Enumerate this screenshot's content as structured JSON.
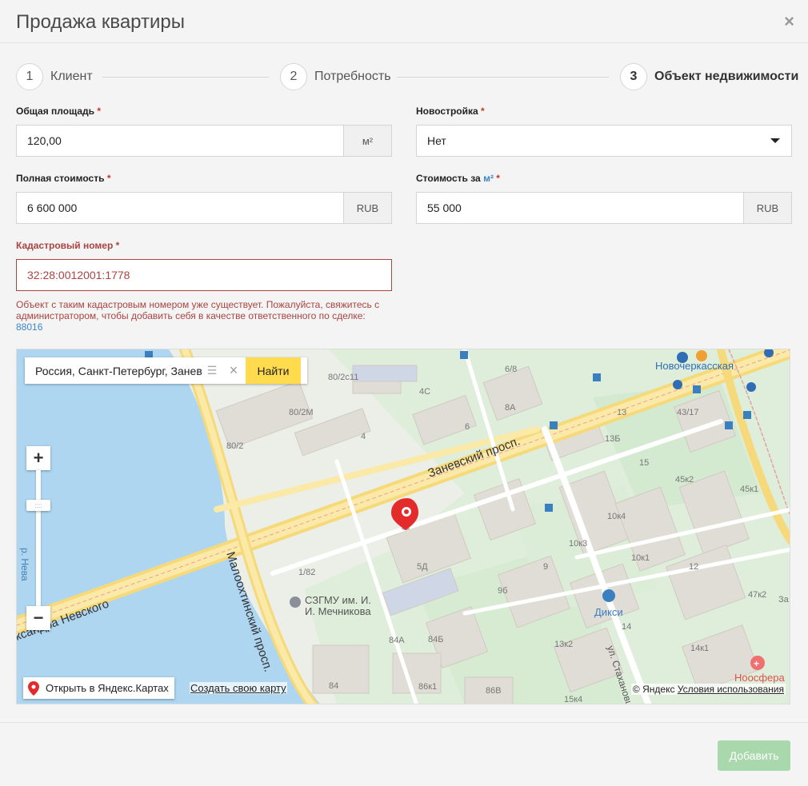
{
  "modal": {
    "title": "Продажа квартиры",
    "close_label": "×"
  },
  "steps": [
    {
      "number": "1",
      "label": "Клиент",
      "active": false
    },
    {
      "number": "2",
      "label": "Потребность",
      "active": false
    },
    {
      "number": "3",
      "label": "Объект недвижимости",
      "active": true
    }
  ],
  "form": {
    "total_area": {
      "label": "Общая площадь",
      "required_mark": "*",
      "value": "120,00",
      "unit": "м²"
    },
    "new_building": {
      "label": "Новостройка",
      "required_mark": "*",
      "value": "Нет"
    },
    "total_price": {
      "label": "Полная стоимость",
      "required_mark": "*",
      "value": "6 600 000",
      "unit": "RUB"
    },
    "price_per_m2": {
      "label_prefix": "Стоимость за",
      "label_unit": "м²",
      "required_mark": "*",
      "value": "55 000",
      "unit": "RUB"
    },
    "cadastral": {
      "label": "Кадастровый номер",
      "required_mark": "*",
      "value": "32:28:0012001:1778"
    },
    "error": {
      "message": "Объект с таким кадастровым номером уже существует. Пожалуйста, свяжитесь с администратором, чтобы добавить себя в качестве ответственного по сделке:",
      "link": "88016"
    }
  },
  "map": {
    "search_value": "Россия, Санкт-Петербург, Заневс",
    "search_button": "Найти",
    "zoom_in": "+",
    "zoom_out": "−",
    "open_button": "Открыть в Яндекс.Картах",
    "create_link": "Создать свою карту",
    "copyright": "© Яндекс",
    "terms": "Условия использования",
    "labels": {
      "zanevsky": "Заневский просп.",
      "malookhtinsky": "Малоохтинский просп.",
      "nevsky": "ксандра Невского",
      "neva": "р. Нева",
      "szgmu1": "СЗГМУ им. И.",
      "szgmu2": "И. Мечникова",
      "dixy": "Дикси",
      "noosfera": "Ноосфера",
      "novocherkasskaya": "Новочеркасская",
      "stakhanovtsev": "ул. Стахановцев",
      "h_80_2c11": "80/2с11",
      "h_80_2m": "80/2М",
      "h_80_2": "80/2",
      "h_4c": "4С",
      "h_6_8": "6/8",
      "h_8a": "8А",
      "h_4": "4",
      "h_6": "6",
      "h_13": "13",
      "h_43_17": "43/17",
      "h_13b": "13Б",
      "h_15": "15",
      "h_45k2": "45к2",
      "h_45k1": "45к1",
      "h_10k4": "10к4",
      "h_10k3": "10к3",
      "h_10k1": "10к1",
      "h_12": "12",
      "h_9": "9",
      "h_5d": "5Д",
      "h_1_82": "1/82",
      "h_9b": "9б",
      "h_47k2": "47к2",
      "h_z": "За",
      "h_14": "14",
      "h_13k2": "13к2",
      "h_14k1": "14к1",
      "h_84a": "84А",
      "h_84b": "84Б",
      "h_84": "84",
      "h_86k1": "86к1",
      "h_86v": "86В",
      "h_15k4": "15к4"
    }
  },
  "footer": {
    "submit_label": "Добавить"
  },
  "colors": {
    "error": "#a94442",
    "link": "#3a86c8",
    "submit_disabled": "#a8d8ac",
    "map_search_button": "#ffdb4d"
  }
}
